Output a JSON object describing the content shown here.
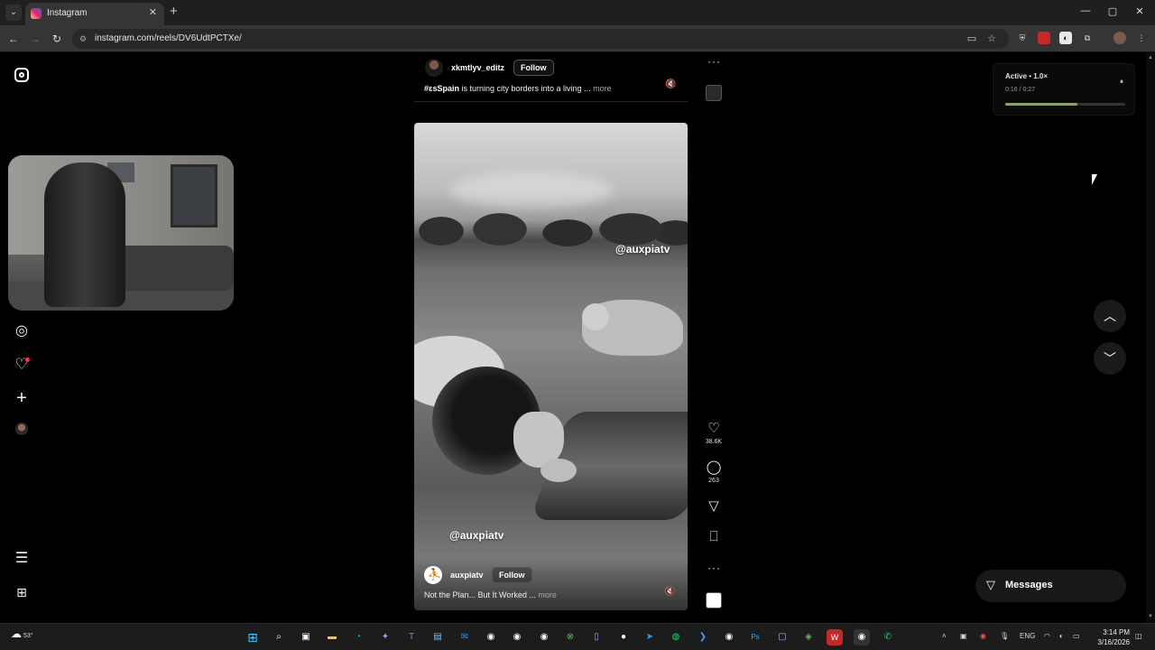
{
  "browser": {
    "tab_title": "Instagram",
    "tab_close": "✕",
    "new_tab": "+",
    "url": "instagram.com/reels/DV6UdtPCTXe/",
    "window_controls": {
      "minimize": "—",
      "maximize": "▢",
      "close": "✕"
    },
    "nav": {
      "back": "←",
      "forward": "→",
      "reload": "↻"
    }
  },
  "left_rail": {
    "icons": [
      "instagram-logo-icon",
      "explore-icon",
      "notifications-heart-icon",
      "create-plus-icon",
      "profile-avatar-icon",
      "more-menu-icon",
      "also-from-meta-icon"
    ]
  },
  "previous_reel": {
    "username": "xkmtlyv_editz",
    "follow_label": "Follow",
    "caption_tag": "#ɛsSpain",
    "caption_text": " is turning city borders into a living ...",
    "caption_more": "more"
  },
  "current_reel": {
    "watermark_top": "@auxpiatv",
    "watermark_bottom": "@auxpiatv",
    "username": "auxpiatv",
    "follow_label": "Follow",
    "caption_text": "Not the Plan... But It Worked ...",
    "caption_more": "more"
  },
  "actions": {
    "likes": "38.6K",
    "comments": "263",
    "more": "···"
  },
  "media_widget": {
    "title": "Active • 1.0×",
    "time": "0:16 / 0:27",
    "progress": 0.6,
    "progress_color": "#8ba36a"
  },
  "messages": {
    "label": "Messages"
  },
  "taskbar": {
    "temperature": "53°",
    "language": "ENG",
    "time": "3:14 PM",
    "date": "3/16/2026"
  }
}
